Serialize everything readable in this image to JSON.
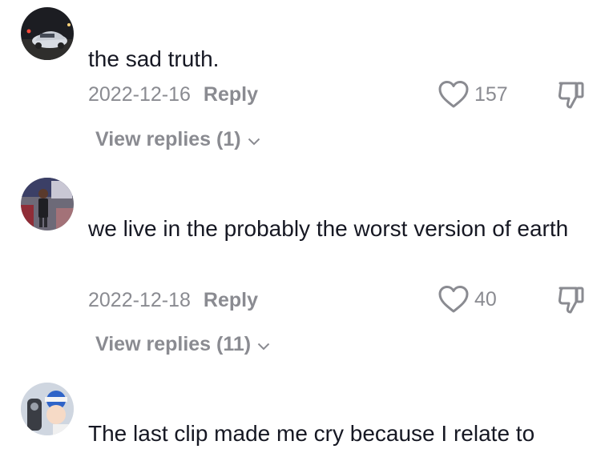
{
  "comments": [
    {
      "text": "the sad truth.",
      "date": "2022-12-16",
      "reply_label": "Reply",
      "likes": "157",
      "view_replies": "View replies (1)",
      "avatar": "car-photo-avatar"
    },
    {
      "text": "we live in the probably the worst version of earth",
      "date": "2022-12-18",
      "reply_label": "Reply",
      "likes": "40",
      "view_replies": "View replies (11)",
      "avatar": "person-photo-avatar"
    },
    {
      "text": "The last clip made me cry because I relate to",
      "avatar": "anime-photo-avatar"
    }
  ],
  "icons": {
    "like": "heart-outline-icon",
    "dislike": "thumbs-down-icon",
    "expand": "chevron-down-icon"
  },
  "colors": {
    "text": "#161823",
    "muted": "#8a8b91",
    "background": "#ffffff"
  }
}
